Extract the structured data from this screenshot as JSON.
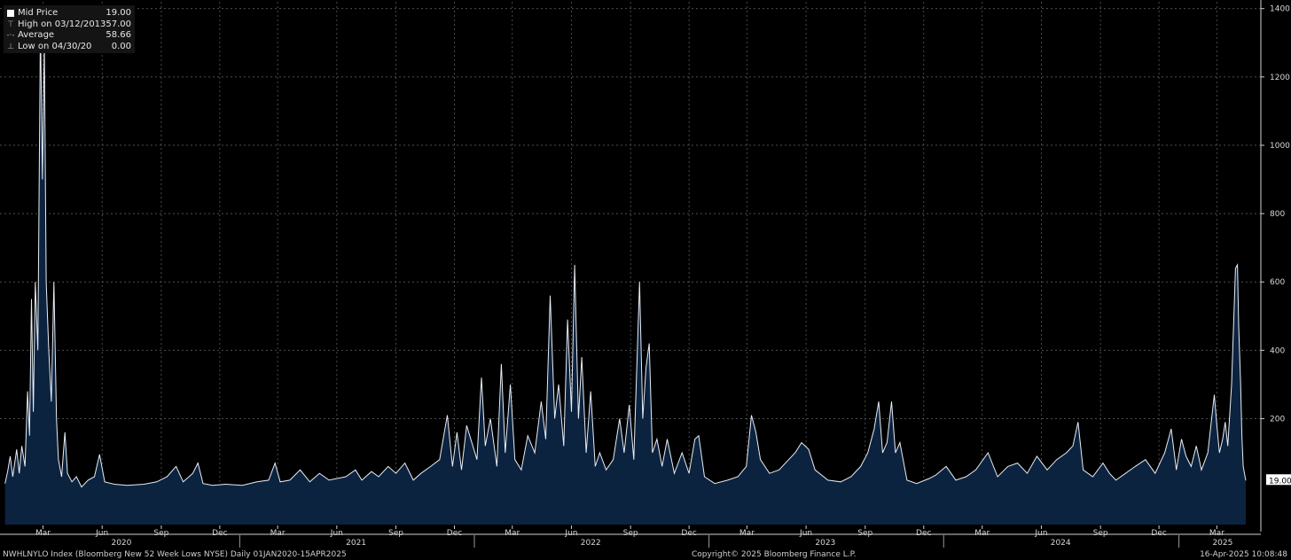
{
  "legend": {
    "rows": [
      {
        "label": "Mid Price",
        "value": "19.00",
        "icon": "white-square"
      },
      {
        "label": "High on 03/12/20",
        "value": "1357.00",
        "icon": "high-marker"
      },
      {
        "label": "Average",
        "value": "58.66",
        "icon": "average-marker"
      },
      {
        "label": "Low on 04/30/20",
        "value": "0.00",
        "icon": "low-marker"
      }
    ]
  },
  "footer": {
    "left": "NWHLNYLO Index (Bloomberg New 52 Week Lows NYSE)  Daily 01JAN2020-15APR2025",
    "center": "Copyright© 2025 Bloomberg Finance L.P.",
    "right": "16-Apr-2025 10:08:48"
  },
  "chart_data": {
    "type": "area",
    "x_start": "2020-01-01",
    "x_end": "2025-04-15",
    "ylim": [
      -110,
      1420
    ],
    "yticks": [
      200,
      400,
      600,
      800,
      1000,
      1200,
      1400
    ],
    "ytick_labels": [
      "200",
      "400",
      "600",
      "800",
      "1000",
      "1200",
      "1400"
    ],
    "last_value_label": "19.00",
    "average_value": 58.66,
    "x_month_labels": [
      {
        "date": "2020-03-01",
        "label": "Mar"
      },
      {
        "date": "2020-06-01",
        "label": "Jun"
      },
      {
        "date": "2020-09-01",
        "label": "Sep"
      },
      {
        "date": "2020-12-01",
        "label": "Dec"
      },
      {
        "date": "2021-03-01",
        "label": "Mar"
      },
      {
        "date": "2021-06-01",
        "label": "Jun"
      },
      {
        "date": "2021-09-01",
        "label": "Sep"
      },
      {
        "date": "2021-12-01",
        "label": "Dec"
      },
      {
        "date": "2022-03-01",
        "label": "Mar"
      },
      {
        "date": "2022-06-01",
        "label": "Jun"
      },
      {
        "date": "2022-09-01",
        "label": "Sep"
      },
      {
        "date": "2022-12-01",
        "label": "Dec"
      },
      {
        "date": "2023-03-01",
        "label": "Mar"
      },
      {
        "date": "2023-06-01",
        "label": "Jun"
      },
      {
        "date": "2023-09-01",
        "label": "Sep"
      },
      {
        "date": "2023-12-01",
        "label": "Dec"
      },
      {
        "date": "2024-03-01",
        "label": "Mar"
      },
      {
        "date": "2024-06-01",
        "label": "Jun"
      },
      {
        "date": "2024-09-01",
        "label": "Sep"
      },
      {
        "date": "2024-12-01",
        "label": "Dec"
      },
      {
        "date": "2025-03-01",
        "label": "Mar"
      }
    ],
    "x_year_labels": [
      {
        "date": "2020-07-01",
        "label": "2020"
      },
      {
        "date": "2021-07-01",
        "label": "2021"
      },
      {
        "date": "2022-07-01",
        "label": "2022"
      },
      {
        "date": "2023-07-01",
        "label": "2023"
      },
      {
        "date": "2024-07-01",
        "label": "2024"
      },
      {
        "date": "2025-03-10",
        "label": "2025"
      }
    ],
    "year_boundaries": [
      "2021-01-01",
      "2022-01-01",
      "2023-01-01",
      "2024-01-01",
      "2025-01-01"
    ],
    "series": [
      {
        "points": [
          [
            "2020-01-02",
            10
          ],
          [
            "2020-01-06",
            45
          ],
          [
            "2020-01-10",
            90
          ],
          [
            "2020-01-14",
            30
          ],
          [
            "2020-01-20",
            110
          ],
          [
            "2020-01-24",
            40
          ],
          [
            "2020-01-28",
            120
          ],
          [
            "2020-02-02",
            60
          ],
          [
            "2020-02-06",
            280
          ],
          [
            "2020-02-09",
            150
          ],
          [
            "2020-02-12",
            550
          ],
          [
            "2020-02-15",
            220
          ],
          [
            "2020-02-18",
            600
          ],
          [
            "2020-02-22",
            400
          ],
          [
            "2020-02-26",
            1357
          ],
          [
            "2020-02-29",
            900
          ],
          [
            "2020-03-03",
            1300
          ],
          [
            "2020-03-06",
            600
          ],
          [
            "2020-03-10",
            400
          ],
          [
            "2020-03-14",
            250
          ],
          [
            "2020-03-18",
            600
          ],
          [
            "2020-03-22",
            200
          ],
          [
            "2020-03-25",
            80
          ],
          [
            "2020-03-30",
            30
          ],
          [
            "2020-04-04",
            160
          ],
          [
            "2020-04-08",
            40
          ],
          [
            "2020-04-15",
            15
          ],
          [
            "2020-04-22",
            30
          ],
          [
            "2020-04-30",
            0
          ],
          [
            "2020-05-10",
            20
          ],
          [
            "2020-05-20",
            30
          ],
          [
            "2020-05-28",
            95
          ],
          [
            "2020-06-05",
            15
          ],
          [
            "2020-06-20",
            8
          ],
          [
            "2020-07-10",
            5
          ],
          [
            "2020-08-05",
            8
          ],
          [
            "2020-08-25",
            15
          ],
          [
            "2020-09-10",
            30
          ],
          [
            "2020-09-24",
            60
          ],
          [
            "2020-10-05",
            15
          ],
          [
            "2020-10-20",
            40
          ],
          [
            "2020-10-28",
            70
          ],
          [
            "2020-11-05",
            10
          ],
          [
            "2020-11-20",
            5
          ],
          [
            "2020-12-10",
            8
          ],
          [
            "2021-01-05",
            5
          ],
          [
            "2021-01-28",
            15
          ],
          [
            "2021-02-15",
            20
          ],
          [
            "2021-02-25",
            70
          ],
          [
            "2021-03-05",
            15
          ],
          [
            "2021-03-20",
            20
          ],
          [
            "2021-04-05",
            50
          ],
          [
            "2021-04-20",
            15
          ],
          [
            "2021-05-05",
            40
          ],
          [
            "2021-05-20",
            20
          ],
          [
            "2021-06-15",
            30
          ],
          [
            "2021-06-30",
            50
          ],
          [
            "2021-07-10",
            20
          ],
          [
            "2021-07-25",
            45
          ],
          [
            "2021-08-05",
            30
          ],
          [
            "2021-08-20",
            60
          ],
          [
            "2021-09-01",
            40
          ],
          [
            "2021-09-15",
            70
          ],
          [
            "2021-09-28",
            20
          ],
          [
            "2021-10-10",
            40
          ],
          [
            "2021-10-25",
            60
          ],
          [
            "2021-11-08",
            80
          ],
          [
            "2021-11-20",
            210
          ],
          [
            "2021-11-28",
            60
          ],
          [
            "2021-12-05",
            160
          ],
          [
            "2021-12-12",
            50
          ],
          [
            "2021-12-20",
            180
          ],
          [
            "2022-01-05",
            80
          ],
          [
            "2022-01-12",
            320
          ],
          [
            "2022-01-18",
            120
          ],
          [
            "2022-01-26",
            200
          ],
          [
            "2022-02-05",
            60
          ],
          [
            "2022-02-12",
            360
          ],
          [
            "2022-02-18",
            100
          ],
          [
            "2022-02-26",
            300
          ],
          [
            "2022-03-05",
            80
          ],
          [
            "2022-03-15",
            50
          ],
          [
            "2022-03-25",
            150
          ],
          [
            "2022-04-05",
            100
          ],
          [
            "2022-04-15",
            250
          ],
          [
            "2022-04-22",
            140
          ],
          [
            "2022-04-29",
            560
          ],
          [
            "2022-05-06",
            200
          ],
          [
            "2022-05-12",
            300
          ],
          [
            "2022-05-20",
            120
          ],
          [
            "2022-05-26",
            490
          ],
          [
            "2022-06-01",
            220
          ],
          [
            "2022-06-06",
            650
          ],
          [
            "2022-06-12",
            200
          ],
          [
            "2022-06-17",
            380
          ],
          [
            "2022-06-24",
            100
          ],
          [
            "2022-07-01",
            280
          ],
          [
            "2022-07-08",
            60
          ],
          [
            "2022-07-15",
            100
          ],
          [
            "2022-07-25",
            50
          ],
          [
            "2022-08-05",
            80
          ],
          [
            "2022-08-15",
            200
          ],
          [
            "2022-08-22",
            100
          ],
          [
            "2022-08-30",
            240
          ],
          [
            "2022-09-06",
            80
          ],
          [
            "2022-09-15",
            600
          ],
          [
            "2022-09-20",
            200
          ],
          [
            "2022-09-25",
            350
          ],
          [
            "2022-09-30",
            420
          ],
          [
            "2022-10-05",
            100
          ],
          [
            "2022-10-12",
            140
          ],
          [
            "2022-10-20",
            60
          ],
          [
            "2022-10-28",
            140
          ],
          [
            "2022-11-08",
            40
          ],
          [
            "2022-11-20",
            100
          ],
          [
            "2022-12-01",
            40
          ],
          [
            "2022-12-10",
            140
          ],
          [
            "2022-12-16",
            150
          ],
          [
            "2022-12-25",
            30
          ],
          [
            "2023-01-10",
            10
          ],
          [
            "2023-01-30",
            20
          ],
          [
            "2023-02-15",
            30
          ],
          [
            "2023-02-28",
            60
          ],
          [
            "2023-03-08",
            210
          ],
          [
            "2023-03-15",
            160
          ],
          [
            "2023-03-22",
            80
          ],
          [
            "2023-04-05",
            40
          ],
          [
            "2023-04-20",
            50
          ],
          [
            "2023-05-05",
            80
          ],
          [
            "2023-05-15",
            100
          ],
          [
            "2023-05-25",
            130
          ],
          [
            "2023-06-05",
            110
          ],
          [
            "2023-06-15",
            50
          ],
          [
            "2023-07-05",
            20
          ],
          [
            "2023-07-25",
            15
          ],
          [
            "2023-08-10",
            30
          ],
          [
            "2023-08-25",
            60
          ],
          [
            "2023-09-05",
            100
          ],
          [
            "2023-09-15",
            170
          ],
          [
            "2023-09-22",
            250
          ],
          [
            "2023-09-28",
            100
          ],
          [
            "2023-10-05",
            130
          ],
          [
            "2023-10-12",
            250
          ],
          [
            "2023-10-18",
            100
          ],
          [
            "2023-10-25",
            130
          ],
          [
            "2023-11-05",
            20
          ],
          [
            "2023-11-20",
            10
          ],
          [
            "2023-12-10",
            25
          ],
          [
            "2023-12-20",
            35
          ],
          [
            "2024-01-05",
            60
          ],
          [
            "2024-01-20",
            20
          ],
          [
            "2024-02-05",
            30
          ],
          [
            "2024-02-20",
            50
          ],
          [
            "2024-03-10",
            100
          ],
          [
            "2024-03-25",
            30
          ],
          [
            "2024-04-10",
            60
          ],
          [
            "2024-04-25",
            70
          ],
          [
            "2024-05-10",
            40
          ],
          [
            "2024-05-25",
            90
          ],
          [
            "2024-06-10",
            50
          ],
          [
            "2024-06-25",
            80
          ],
          [
            "2024-07-10",
            100
          ],
          [
            "2024-07-20",
            120
          ],
          [
            "2024-07-28",
            190
          ],
          [
            "2024-08-05",
            50
          ],
          [
            "2024-08-20",
            30
          ],
          [
            "2024-09-05",
            70
          ],
          [
            "2024-09-15",
            40
          ],
          [
            "2024-09-25",
            20
          ],
          [
            "2024-10-10",
            40
          ],
          [
            "2024-10-25",
            60
          ],
          [
            "2024-11-10",
            80
          ],
          [
            "2024-11-25",
            40
          ],
          [
            "2024-12-10",
            100
          ],
          [
            "2024-12-20",
            170
          ],
          [
            "2024-12-28",
            50
          ],
          [
            "2025-01-05",
            140
          ],
          [
            "2025-01-12",
            90
          ],
          [
            "2025-01-20",
            60
          ],
          [
            "2025-01-28",
            120
          ],
          [
            "2025-02-05",
            50
          ],
          [
            "2025-02-15",
            100
          ],
          [
            "2025-02-25",
            270
          ],
          [
            "2025-03-01",
            180
          ],
          [
            "2025-03-05",
            100
          ],
          [
            "2025-03-10",
            140
          ],
          [
            "2025-03-14",
            190
          ],
          [
            "2025-03-18",
            120
          ],
          [
            "2025-03-24",
            300
          ],
          [
            "2025-03-30",
            640
          ],
          [
            "2025-04-02",
            650
          ],
          [
            "2025-04-04",
            470
          ],
          [
            "2025-04-07",
            300
          ],
          [
            "2025-04-09",
            150
          ],
          [
            "2025-04-11",
            60
          ],
          [
            "2025-04-15",
            19
          ]
        ]
      }
    ]
  }
}
